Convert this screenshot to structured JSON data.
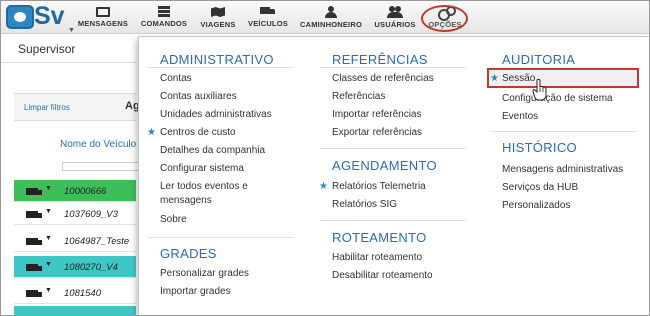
{
  "app": {
    "logo_text": "Sv"
  },
  "nav": {
    "items": [
      {
        "label": "MENSAGENS",
        "icon": "mail-icon"
      },
      {
        "label": "COMANDOS",
        "icon": "list-icon"
      },
      {
        "label": "VIAGENS",
        "icon": "map-icon"
      },
      {
        "label": "VEÍCULOS",
        "icon": "truck-icon"
      },
      {
        "label": "CAMINHONEIRO",
        "icon": "user-icon"
      },
      {
        "label": "USUÁRIOS",
        "icon": "users-icon"
      },
      {
        "label": "OPÇÕES",
        "icon": "gear-icon"
      }
    ]
  },
  "page": {
    "title": "Supervisor",
    "clear_filters": "Limpar filtros",
    "grid_header_partial": "Ag",
    "column_vehicle": "Nome do Veículo",
    "rows": [
      {
        "id": "10000666",
        "color": "#3dbe5a"
      },
      {
        "id": "1037609_V3",
        "color": "#ffffff"
      },
      {
        "id": "1064987_Teste",
        "color": "#ffffff"
      },
      {
        "id": "1080270_V4",
        "color": "#3fc6c6"
      },
      {
        "id": "1081540",
        "color": "#ffffff"
      },
      {
        "id": "",
        "color": "#3fc6c6"
      }
    ]
  },
  "menu": {
    "administrativo": {
      "title": "ADMINISTRATIVO",
      "items": [
        "Contas",
        "Contas auxiliares",
        "Unidades administrativas",
        "Centros de custo",
        "Detalhes da companhia",
        "Configurar sistema",
        "Ler todos eventos e",
        "mensagens",
        "Sobre"
      ]
    },
    "grades": {
      "title": "GRADES",
      "items": [
        "Personalizar grades",
        "Importar grades"
      ]
    },
    "referencias": {
      "title": "REFERÊNCIAS",
      "items": [
        "Classes de referências",
        "Referências",
        "Importar referências",
        "Exportar referências"
      ]
    },
    "agendamento": {
      "title": "AGENDAMENTO",
      "items": [
        "Relatórios Telemetria",
        "Relatórios SIG"
      ]
    },
    "roteamento": {
      "title": "ROTEAMENTO",
      "items": [
        "Habilitar roteamento",
        "Desabilitar roteamento"
      ]
    },
    "auditoria": {
      "title": "AUDITORIA",
      "items": [
        "Sessão",
        "Configuração de sistema",
        "Eventos"
      ]
    },
    "historico": {
      "title": "HISTÓRICO",
      "items": [
        "Mensagens administrativas",
        "Serviços da HUB",
        "Personalizados"
      ]
    }
  },
  "colors": {
    "accent": "#2a6cb5",
    "highlight": "#c0392b"
  }
}
